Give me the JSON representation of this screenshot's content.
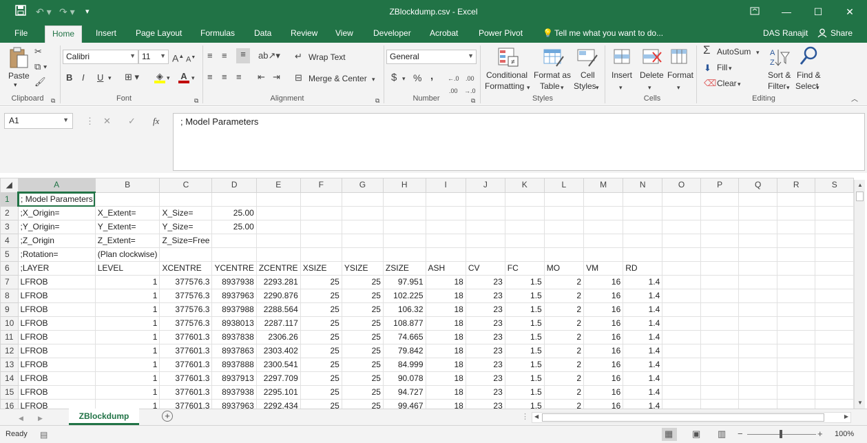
{
  "title_bar": {
    "title": "ZBlockdump.csv - Excel",
    "qat_customize": "▾"
  },
  "menu": {
    "tabs": [
      "File",
      "Home",
      "Insert",
      "Page Layout",
      "Formulas",
      "Data",
      "Review",
      "View",
      "Developer",
      "Acrobat",
      "Power Pivot"
    ],
    "tell_me": "Tell me what you want to do...",
    "user": "DAS Ranajit",
    "share": "Share"
  },
  "ribbon": {
    "clipboard": {
      "paste": "Paste",
      "label": "Clipboard"
    },
    "font": {
      "name": "Calibri",
      "size": "11",
      "label": "Font",
      "bold": "B",
      "italic": "I",
      "underline": "U",
      "grow": "A",
      "shrink": "A",
      "fontcolor": "A"
    },
    "alignment": {
      "wrap": "Wrap Text",
      "merge": "Merge & Center",
      "label": "Alignment"
    },
    "number": {
      "format": "General",
      "currency": "$",
      "percent": "%",
      "comma": ",",
      "label": "Number"
    },
    "styles": {
      "conditional": [
        "Conditional",
        "Formatting"
      ],
      "table": [
        "Format as",
        "Table"
      ],
      "cell": [
        "Cell",
        "Styles"
      ],
      "label": "Styles"
    },
    "cells": {
      "insert": "Insert",
      "delete": "Delete",
      "format": "Format",
      "label": "Cells"
    },
    "editing": {
      "autosum": "AutoSum",
      "fill": "Fill",
      "clear": "Clear",
      "sort": [
        "Sort &",
        "Filter"
      ],
      "find": [
        "Find &",
        "Select"
      ],
      "label": "Editing"
    }
  },
  "formula_bar": {
    "name_box": "A1",
    "fx": "fx",
    "content": ";  Model Parameters"
  },
  "grid": {
    "columns": [
      "A",
      "B",
      "C",
      "D",
      "E",
      "F",
      "G",
      "H",
      "I",
      "J",
      "K",
      "L",
      "M",
      "N",
      "O",
      "P",
      "Q",
      "R",
      "S"
    ],
    "row_numbers": [
      "1",
      "2",
      "3",
      "4",
      "5",
      "6",
      "7",
      "8",
      "9",
      "10",
      "11",
      "12",
      "13",
      "14",
      "15",
      "16"
    ],
    "text_rows": [
      [
        ";  Model Parameters"
      ],
      [
        ";X_Origin=",
        "X_Extent=",
        "X_Size=",
        "25.00"
      ],
      [
        ";Y_Origin=",
        "Y_Extent=",
        "Y_Size=",
        "25.00"
      ],
      [
        ";Z_Origin",
        "Z_Extent=",
        "Z_Size=Free"
      ],
      [
        ";Rotation=",
        "(Plan clockwise)"
      ],
      [
        ";LAYER",
        "LEVEL",
        "XCENTRE",
        "YCENTRE",
        "ZCENTRE",
        "XSIZE",
        "YSIZE",
        "ZSIZE",
        "ASH",
        "CV",
        "FC",
        "MO",
        "VM",
        "RD"
      ]
    ],
    "data_rows": [
      [
        "LFROB",
        "1",
        "377576.3",
        "8937938",
        "2293.281",
        "25",
        "25",
        "97.951",
        "18",
        "23",
        "1.5",
        "2",
        "16",
        "1.4"
      ],
      [
        "LFROB",
        "1",
        "377576.3",
        "8937963",
        "2290.876",
        "25",
        "25",
        "102.225",
        "18",
        "23",
        "1.5",
        "2",
        "16",
        "1.4"
      ],
      [
        "LFROB",
        "1",
        "377576.3",
        "8937988",
        "2288.564",
        "25",
        "25",
        "106.32",
        "18",
        "23",
        "1.5",
        "2",
        "16",
        "1.4"
      ],
      [
        "LFROB",
        "1",
        "377576.3",
        "8938013",
        "2287.117",
        "25",
        "25",
        "108.877",
        "18",
        "23",
        "1.5",
        "2",
        "16",
        "1.4"
      ],
      [
        "LFROB",
        "1",
        "377601.3",
        "8937838",
        "2306.26",
        "25",
        "25",
        "74.665",
        "18",
        "23",
        "1.5",
        "2",
        "16",
        "1.4"
      ],
      [
        "LFROB",
        "1",
        "377601.3",
        "8937863",
        "2303.402",
        "25",
        "25",
        "79.842",
        "18",
        "23",
        "1.5",
        "2",
        "16",
        "1.4"
      ],
      [
        "LFROB",
        "1",
        "377601.3",
        "8937888",
        "2300.541",
        "25",
        "25",
        "84.999",
        "18",
        "23",
        "1.5",
        "2",
        "16",
        "1.4"
      ],
      [
        "LFROB",
        "1",
        "377601.3",
        "8937913",
        "2297.709",
        "25",
        "25",
        "90.078",
        "18",
        "23",
        "1.5",
        "2",
        "16",
        "1.4"
      ],
      [
        "LFROB",
        "1",
        "377601.3",
        "8937938",
        "2295.101",
        "25",
        "25",
        "94.727",
        "18",
        "23",
        "1.5",
        "2",
        "16",
        "1.4"
      ],
      [
        "LFROB",
        "1",
        "377601.3",
        "8937963",
        "2292.434",
        "25",
        "25",
        "99.467",
        "18",
        "23",
        "1.5",
        "2",
        "16",
        "1.4"
      ]
    ]
  },
  "sheet": {
    "tab": "ZBlockdump",
    "add": "+"
  },
  "status": {
    "ready": "Ready",
    "zoom": "100%"
  },
  "colors": {
    "accent": "#217346",
    "ribbon_bg": "#f3f3f3"
  }
}
